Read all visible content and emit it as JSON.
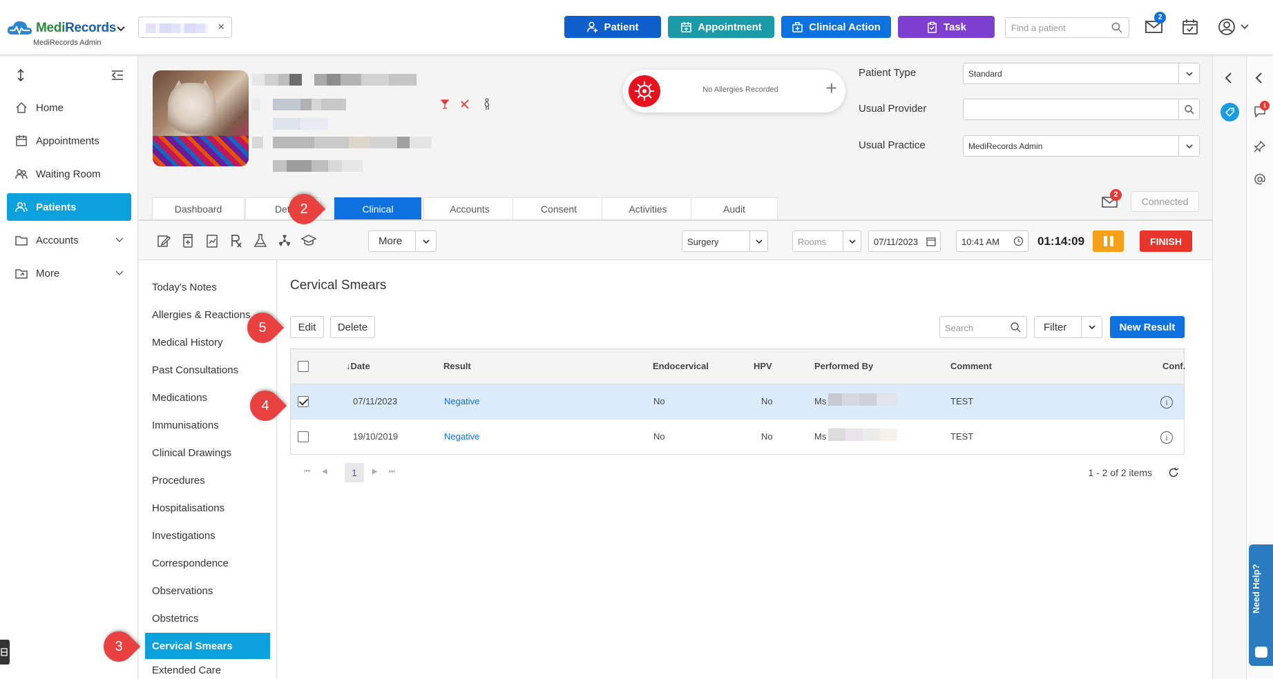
{
  "app": {
    "brand_prefix": "Medi",
    "brand_suffix": "Records",
    "org": "MediRecords Admin"
  },
  "topbar": {
    "buttons": [
      {
        "label": "Patient"
      },
      {
        "label": "Appointment"
      },
      {
        "label": "Clinical Action"
      },
      {
        "label": "Task"
      }
    ],
    "find_patient_placeholder": "Find a patient",
    "mail_badge": "2",
    "colors": {
      "patient": "#0e5fcc",
      "appointment": "#1b9ba8",
      "clinical_action": "#0d72e0",
      "task": "#7d3fcf"
    }
  },
  "sidebar": {
    "items": [
      {
        "label": "Home",
        "icon": "home-icon"
      },
      {
        "label": "Appointments",
        "icon": "calendar-icon"
      },
      {
        "label": "Waiting Room",
        "icon": "people-icon"
      },
      {
        "label": "Patients",
        "icon": "patients-icon",
        "active": true
      },
      {
        "label": "Accounts",
        "icon": "folder-icon"
      },
      {
        "label": "More",
        "icon": "folder-share-icon"
      }
    ]
  },
  "patient_header": {
    "allergy_text": "No Allergies Recorded",
    "patient_type_label": "Patient Type",
    "patient_type_value": "Standard",
    "usual_provider_label": "Usual Provider",
    "usual_provider_value": "",
    "usual_practice_label": "Usual Practice",
    "usual_practice_value": "MediRecords Admin",
    "connected_label": "Connected",
    "mail_badge": "2"
  },
  "tabs": [
    {
      "label": "Dashboard"
    },
    {
      "label": "Det"
    },
    {
      "label": "Clinical",
      "active": true
    },
    {
      "label": "Accounts"
    },
    {
      "label": "Consent"
    },
    {
      "label": "Activities"
    },
    {
      "label": "Audit"
    }
  ],
  "toolbar": {
    "more_label": "More",
    "location": "Surgery",
    "rooms_placeholder": "Rooms",
    "date": "07/11/2023",
    "time": "10:41 AM",
    "timer": "01:14:09",
    "finish_label": "FINISH"
  },
  "clinical_menu": [
    "Today's Notes",
    "Allergies & Reactions",
    "Medical History",
    "Past Consultations",
    "Medications",
    "Immunisations",
    "Clinical Drawings",
    "Procedures",
    "Hospitalisations",
    "Investigations",
    "Correspondence",
    "Observations",
    "Obstetrics",
    "Cervical Smears",
    "Extended Care"
  ],
  "clinical_menu_active": "Cervical Smears",
  "content": {
    "title": "Cervical Smears",
    "edit_label": "Edit",
    "delete_label": "Delete",
    "search_placeholder": "Search",
    "filter_label": "Filter",
    "new_result_label": "New Result",
    "columns": [
      "↓Date",
      "Result",
      "Endocervical",
      "HPV",
      "Performed By",
      "Comment",
      "Conf."
    ],
    "rows": [
      {
        "date": "07/11/2023",
        "result": "Negative",
        "endocervical": "No",
        "hpv": "No",
        "performed_by": "Ms",
        "comment": "TEST",
        "selected": true
      },
      {
        "date": "19/10/2019",
        "result": "Negative",
        "endocervical": "No",
        "hpv": "No",
        "performed_by": "Ms",
        "comment": "TEST",
        "selected": false
      }
    ],
    "pager": {
      "current": "1",
      "info": "1 - 2 of 2 items"
    }
  },
  "right_rail": {
    "chat_badge": "1",
    "need_help": "Need Help?"
  },
  "markers": [
    "2",
    "3",
    "4",
    "5"
  ]
}
